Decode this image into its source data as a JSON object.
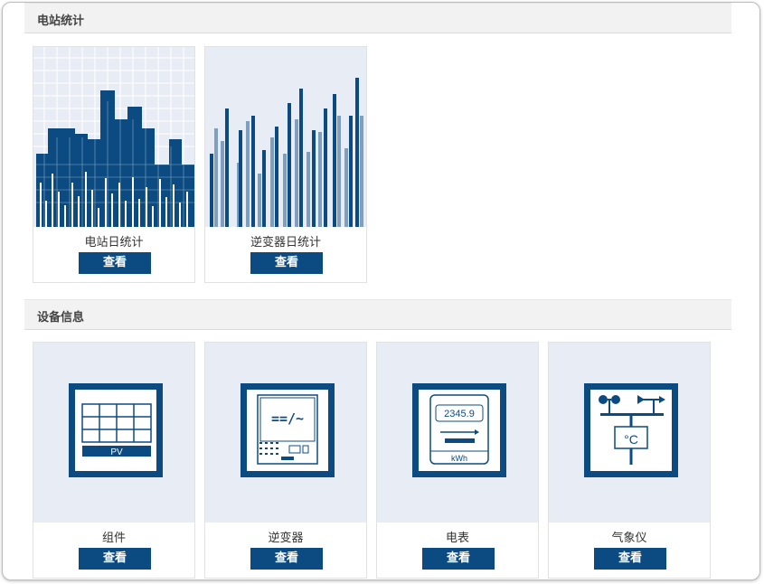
{
  "sections": {
    "station_stats": {
      "title": "电站统计",
      "cards": [
        {
          "label": "电站日统计",
          "button": "查看",
          "icon": "station-daily-chart-icon"
        },
        {
          "label": "逆变器日统计",
          "button": "查看",
          "icon": "inverter-daily-chart-icon"
        }
      ]
    },
    "device_info": {
      "title": "设备信息",
      "cards": [
        {
          "label": "组件",
          "button": "查看",
          "icon": "pv-module-icon",
          "icon_text": "PV"
        },
        {
          "label": "逆变器",
          "button": "查看",
          "icon": "inverter-icon",
          "icon_text": "==/~"
        },
        {
          "label": "电表",
          "button": "查看",
          "icon": "electric-meter-icon",
          "icon_text": "2345.9",
          "icon_unit": "kWh"
        },
        {
          "label": "气象仪",
          "button": "查看",
          "icon": "weather-station-icon",
          "icon_text": "°C"
        }
      ]
    }
  },
  "colors": {
    "accent": "#0c4b82",
    "light_accent": "#7f9fbf",
    "card_bg": "#e8edf5"
  }
}
